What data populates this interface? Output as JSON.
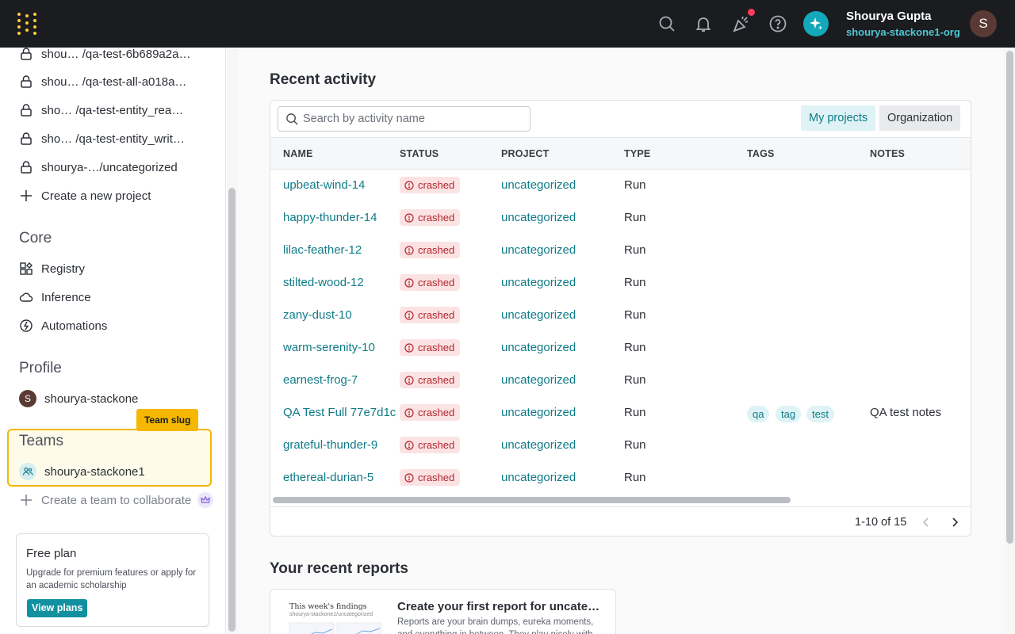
{
  "header": {
    "user_name": "Shourya Gupta",
    "user_org": "shourya-stackone1-org",
    "avatar_letter": "S",
    "icons": [
      "search-icon",
      "bell-icon",
      "party-popper-icon",
      "help-icon",
      "sparkle-icon"
    ],
    "colors": {
      "bar": "#1a1c1f",
      "logo": "#ffcc33",
      "accent": "#13a9ba",
      "notification": "#ff3b5c"
    }
  },
  "sidebar": {
    "projects": [
      {
        "label": "shou… /qa-test-6b689a2a…",
        "icon": "lock-icon"
      },
      {
        "label": "shou… /qa-test-all-a018a…",
        "icon": "lock-icon"
      },
      {
        "label": "sho… /qa-test-entity_rea…",
        "icon": "lock-icon"
      },
      {
        "label": "sho… /qa-test-entity_writ…",
        "icon": "lock-icon"
      },
      {
        "label": "shourya-…/uncategorized",
        "icon": "lock-icon"
      }
    ],
    "create_project": "Create a new project",
    "core_heading": "Core",
    "core_items": [
      {
        "label": "Registry",
        "icon": "registry-icon"
      },
      {
        "label": "Inference",
        "icon": "cloud-icon"
      },
      {
        "label": "Automations",
        "icon": "automation-icon"
      }
    ],
    "profile_heading": "Profile",
    "profile_name": "shourya-stackone",
    "profile_avatar_letter": "S",
    "team_slug_tooltip": "Team slug",
    "teams_heading": "Teams",
    "team_name": "shourya-stackone1",
    "create_team": "Create a team to collaborate",
    "plan": {
      "title": "Free plan",
      "description": "Upgrade for premium features or apply for an academic scholarship",
      "button": "View plans"
    }
  },
  "main": {
    "recent_activity_title": "Recent activity",
    "search_placeholder": "Search by activity name",
    "filter_tabs": {
      "active": "My projects",
      "inactive": "Organization"
    },
    "columns": [
      "NAME",
      "STATUS",
      "PROJECT",
      "TYPE",
      "TAGS",
      "NOTES"
    ],
    "rows": [
      {
        "name": "upbeat-wind-14",
        "status": "crashed",
        "project": "uncategorized",
        "type": "Run",
        "tags": [],
        "notes": ""
      },
      {
        "name": "happy-thunder-14",
        "status": "crashed",
        "project": "uncategorized",
        "type": "Run",
        "tags": [],
        "notes": ""
      },
      {
        "name": "lilac-feather-12",
        "status": "crashed",
        "project": "uncategorized",
        "type": "Run",
        "tags": [],
        "notes": ""
      },
      {
        "name": "stilted-wood-12",
        "status": "crashed",
        "project": "uncategorized",
        "type": "Run",
        "tags": [],
        "notes": ""
      },
      {
        "name": "zany-dust-10",
        "status": "crashed",
        "project": "uncategorized",
        "type": "Run",
        "tags": [],
        "notes": ""
      },
      {
        "name": "warm-serenity-10",
        "status": "crashed",
        "project": "uncategorized",
        "type": "Run",
        "tags": [],
        "notes": ""
      },
      {
        "name": "earnest-frog-7",
        "status": "crashed",
        "project": "uncategorized",
        "type": "Run",
        "tags": [],
        "notes": ""
      },
      {
        "name": "QA Test Full 77e7d1c",
        "status": "crashed",
        "project": "uncategorized",
        "type": "Run",
        "tags": [
          "qa",
          "tag",
          "test"
        ],
        "notes": "QA test notes"
      },
      {
        "name": "grateful-thunder-9",
        "status": "crashed",
        "project": "uncategorized",
        "type": "Run",
        "tags": [],
        "notes": ""
      },
      {
        "name": "ethereal-durian-5",
        "status": "crashed",
        "project": "uncategorized",
        "type": "Run",
        "tags": [],
        "notes": ""
      }
    ],
    "pagination": "1-10 of 15",
    "recent_reports_title": "Your recent reports",
    "report_card": {
      "thumb_title": "This week's findings",
      "thumb_subtitle": "shourya-stackone1/uncategorized",
      "title": "Create your first report for uncateg…",
      "description": "Reports are your brain dumps, eureka moments, and everything in between. They play nicely with"
    }
  }
}
